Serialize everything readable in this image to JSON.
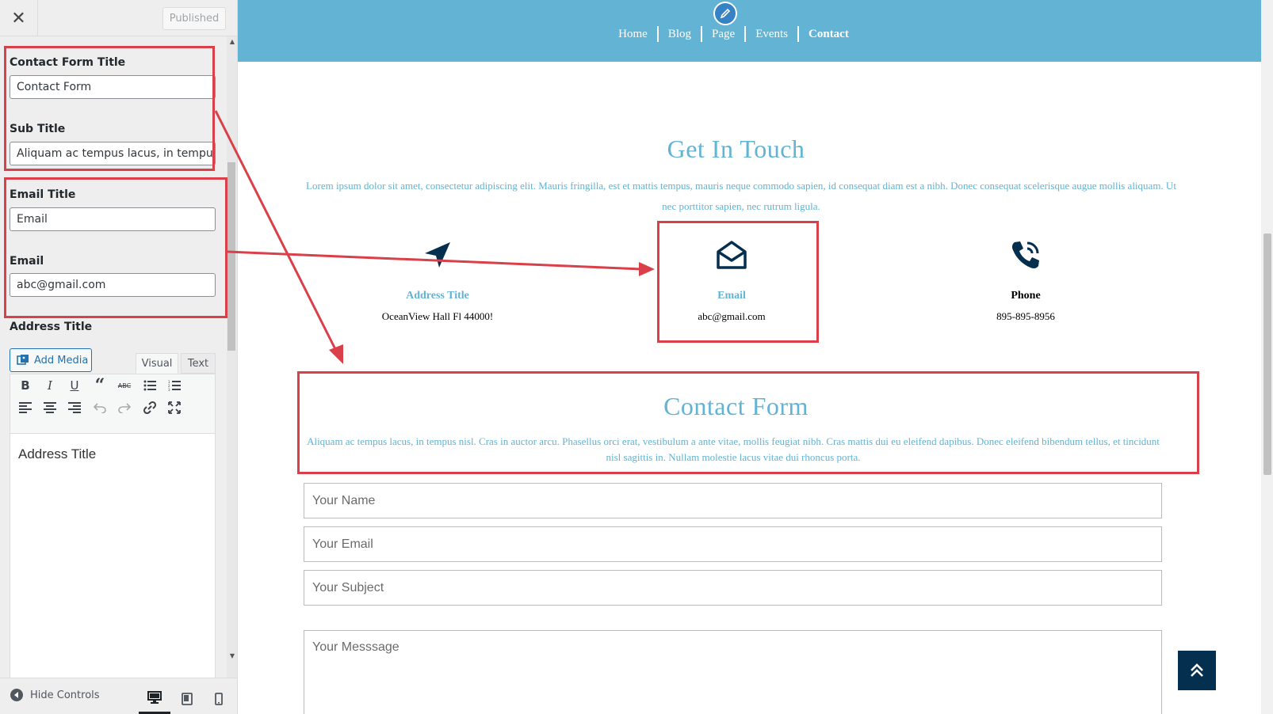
{
  "sidebar": {
    "published_label": "Published",
    "fields": {
      "contact_form_title_label": "Contact Form Title",
      "contact_form_title_value": "Contact Form",
      "sub_title_label": "Sub Title",
      "sub_title_value": "Aliquam ac tempus lacus, in tempus nisl",
      "email_title_label": "Email Title",
      "email_title_value": "Email",
      "email_label": "Email",
      "email_value": "abc@gmail.com",
      "address_title_label": "Address Title"
    },
    "editor": {
      "add_media_label": "Add Media",
      "tab_visual": "Visual",
      "tab_text": "Text",
      "content": "Address Title"
    },
    "footer": {
      "hide_controls_label": "Hide Controls"
    }
  },
  "preview": {
    "nav": [
      "Home",
      "Blog",
      "Page",
      "Events",
      "Contact"
    ],
    "get_in_touch": {
      "title": "Get In Touch",
      "text": "Lorem ipsum dolor sit amet, consectetur adipiscing elit. Mauris fringilla, est et mattis tempus, mauris neque commodo sapien, id consequat diam est a nibh. Donec consequat scelerisque augue mollis aliquam. Ut nec porttitor sapien, nec rutrum ligula."
    },
    "info": {
      "address": {
        "title": "Address Title",
        "value": "OceanView Hall Fl 44000!"
      },
      "email": {
        "title": "Email",
        "value": "abc@gmail.com"
      },
      "phone": {
        "title": "Phone",
        "value": "895-895-8956"
      }
    },
    "contact_form": {
      "title": "Contact Form",
      "subtitle": "Aliquam ac tempus lacus, in tempus nisl. Cras in auctor arcu. Phasellus orci erat, vestibulum a ante vitae, mollis feugiat nibh. Cras mattis dui eu eleifend dapibus. Donec eleifend bibendum tellus, et tincidunt nisl sagittis in. Nullam molestie lacus vitae dui rhoncus porta.",
      "name_placeholder": "Your Name",
      "email_placeholder": "Your Email",
      "subject_placeholder": "Your Subject",
      "message_placeholder": "Your Messsage"
    }
  },
  "colors": {
    "accent": "#62b3d4",
    "dark_icon": "#052f4f",
    "annotation": "#d9404a"
  },
  "icons": [
    "close-icon",
    "add-media-icon",
    "bold-icon",
    "italic-icon",
    "underline-icon",
    "blockquote-icon",
    "strikethrough-icon",
    "bullet-list-icon",
    "numbered-list-icon",
    "align-left-icon",
    "align-center-icon",
    "align-right-icon",
    "undo-icon",
    "redo-icon",
    "link-icon",
    "fullscreen-icon",
    "hide-controls-icon",
    "desktop-icon",
    "tablet-icon",
    "mobile-icon",
    "pencil-icon",
    "paper-plane-icon",
    "envelope-open-icon",
    "phone-icon",
    "chevrons-up-icon"
  ]
}
